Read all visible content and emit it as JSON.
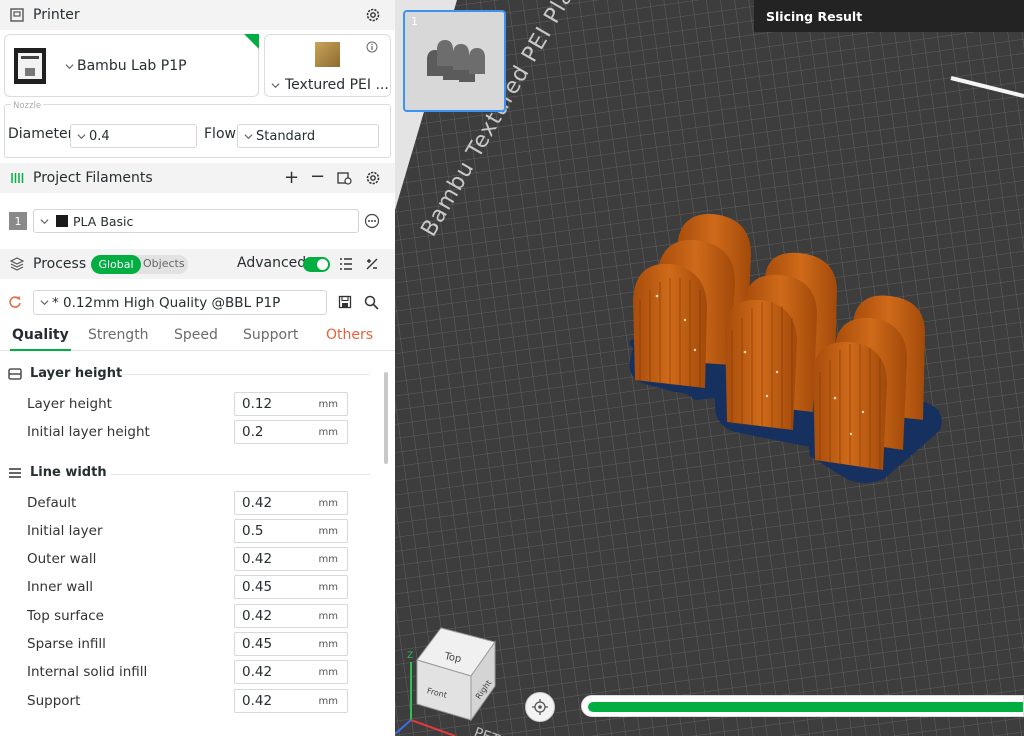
{
  "printer": {
    "title": "Printer",
    "name": "Bambu Lab P1P",
    "plate": "Textured PEI ...",
    "nozzle_legend": "Nozzle",
    "diameter_label": "Diameter",
    "diameter_value": "0.4",
    "flow_label": "Flow",
    "flow_value": "Standard"
  },
  "filaments": {
    "title": "Project Filaments",
    "items": [
      {
        "index": "1",
        "name": "PLA Basic"
      }
    ]
  },
  "process": {
    "title": "Process",
    "toggle_global": "Global",
    "toggle_objects": "Objects",
    "advanced_label": "Advanced",
    "preset": "* 0.12mm High Quality @BBL P1P",
    "tabs": [
      "Quality",
      "Strength",
      "Speed",
      "Support",
      "Others"
    ],
    "groups": [
      {
        "title": "Layer height",
        "rows": [
          {
            "label": "Layer height",
            "value": "0.12",
            "unit": "mm"
          },
          {
            "label": "Initial layer height",
            "value": "0.2",
            "unit": "mm"
          }
        ]
      },
      {
        "title": "Line width",
        "rows": [
          {
            "label": "Default",
            "value": "0.42",
            "unit": "mm"
          },
          {
            "label": "Initial layer",
            "value": "0.5",
            "unit": "mm"
          },
          {
            "label": "Outer wall",
            "value": "0.42",
            "unit": "mm"
          },
          {
            "label": "Inner wall",
            "value": "0.45",
            "unit": "mm"
          },
          {
            "label": "Top surface",
            "value": "0.42",
            "unit": "mm"
          },
          {
            "label": "Sparse infill",
            "value": "0.45",
            "unit": "mm"
          },
          {
            "label": "Internal solid infill",
            "value": "0.42",
            "unit": "mm"
          },
          {
            "label": "Support",
            "value": "0.42",
            "unit": "mm"
          }
        ]
      }
    ]
  },
  "viewport": {
    "plate_number": "1",
    "slicing_result": "Slicing Result",
    "bed_text": "Bambu Textured PEI Plate",
    "bed_text_bottom": "PET",
    "cube_top": "Top",
    "cube_front": "Front",
    "cube_right": "Right",
    "axis_z": "Z",
    "slice_progress": 1.0
  },
  "colors": {
    "accent": "#00ae42",
    "selection": "#3a93f2",
    "filament": "#1a1a1a"
  }
}
